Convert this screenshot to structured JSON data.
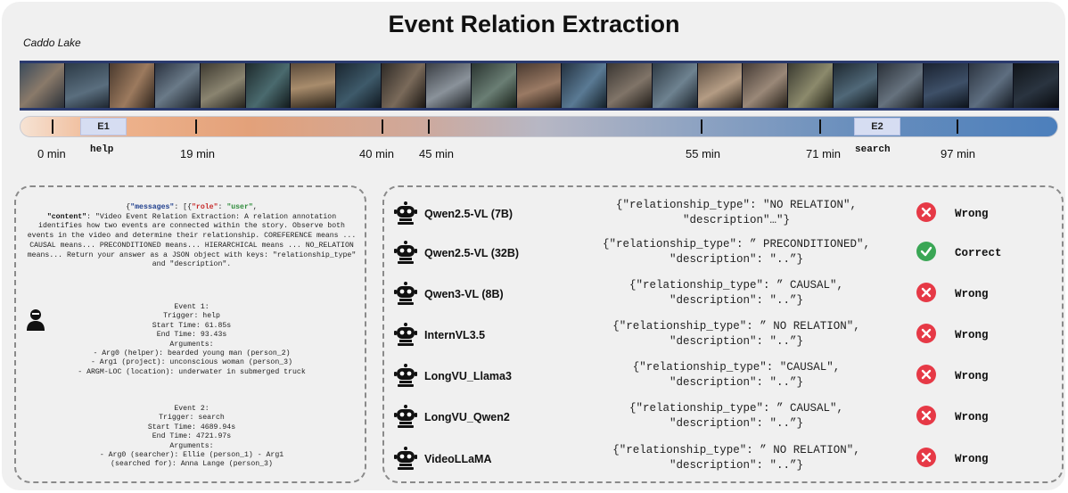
{
  "title": "Event Relation Extraction",
  "subtitle": "Caddo Lake",
  "timeline": {
    "event1_label": "E1",
    "event1_trigger": "help",
    "event2_label": "E2",
    "event2_trigger": "search",
    "time_labels": [
      "0 min",
      "19 min",
      "40 min",
      "45 min",
      "55 min",
      "71 min",
      "97 min"
    ]
  },
  "prompt": {
    "open_brace": "{",
    "messages_key": "\"messages\"",
    "sep1": ": [{",
    "role_key": "\"role\"",
    "sep2": ": ",
    "role_val": "\"user\"",
    "sep3": ",",
    "content_key": "\"content\"",
    "content_text": ": \"Video Event Relation Extraction: A relation annotation identifies how two events are connected within the story. Observe both events in the video and determine their relationship. COREFERENCE means ... CAUSAL means... PRECONDITIONED means... HIERARCHICAL means ... NO_RELATION means... Return your answer as a JSON object with keys: \"relationship_type\" and \"description\"."
  },
  "event1": {
    "heading": "Event 1:",
    "trigger": "Trigger: help",
    "start": "Start Time: 61.85s",
    "end": "End Time: 93.43s",
    "args_heading": "Arguments:",
    "args": [
      "- Arg0 (helper): bearded young man (person_2)",
      "- Arg1 (project): unconscious woman (person_3)",
      "- ARGM-LOC (location): underwater in submerged truck"
    ]
  },
  "event2": {
    "heading": "Event 2:",
    "trigger": "Trigger: search",
    "start": "Start Time: 4689.94s",
    "end": "End Time: 4721.97s",
    "args_heading": "Arguments:",
    "args": [
      "- Arg0 (searcher): Ellie (person_1)    - Arg1",
      "(searched for): Anna Lange (person_3)"
    ]
  },
  "results": [
    {
      "model": "Qwen2.5-VL (7B)",
      "line1": "{\"relationship_type\": \"NO RELATION\",",
      "line2": "\"description\"…\"}",
      "verdict": "Wrong",
      "correct": false
    },
    {
      "model": "Qwen2.5-VL (32B)",
      "line1": "{\"relationship_type\": ” PRECONDITIONED\",",
      "line2": "\"description\": \"..”}",
      "verdict": "Correct",
      "correct": true
    },
    {
      "model": "Qwen3-VL (8B)",
      "line1": "{\"relationship_type\": ” CAUSAL\",",
      "line2": "\"description\": \"..”}",
      "verdict": "Wrong",
      "correct": false
    },
    {
      "model": "InternVL3.5",
      "line1": "{\"relationship_type\": ” NO RELATION\",",
      "line2": "\"description\": \"..”}",
      "verdict": "Wrong",
      "correct": false
    },
    {
      "model": "LongVU_Llama3",
      "line1": "{\"relationship_type\": \"CAUSAL\",",
      "line2": "\"description\": \"..”}",
      "verdict": "Wrong",
      "correct": false
    },
    {
      "model": "LongVU_Qwen2",
      "line1": "{\"relationship_type\": ” CAUSAL\",",
      "line2": "\"description\": \"..”}",
      "verdict": "Wrong",
      "correct": false
    },
    {
      "model": "VideoLLaMA",
      "line1": "{\"relationship_type\": ” NO RELATION\",",
      "line2": "\"description\": \"..”}",
      "verdict": "Wrong",
      "correct": false
    }
  ]
}
